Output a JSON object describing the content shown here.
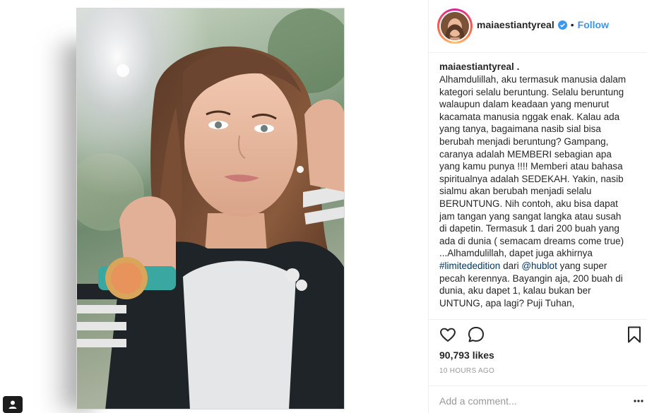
{
  "post": {
    "username": "maiaestiantyreal",
    "separator": "•",
    "follow_label": "Follow",
    "caption_user": "maiaestiantyreal",
    "caption_user_suffix": " .",
    "caption_lines": [
      "Alhamdulillah, aku termasuk manusia dalam",
      "kategori selalu beruntung. Selalu beruntung",
      "walaupun dalam keadaan yang menurut",
      "kacamata manusia nggak enak. Kalau ada",
      "yang tanya, bagaimana nasib sial bisa",
      "berubah menjadi beruntung? Gampang,",
      "caranya adalah MEMBERI sebagian apa",
      "yang kamu punya !!!! Memberi atau bahasa",
      "spiritualnya adalah SEDEKAH. Yakin, nasib",
      "sialmu akan berubah menjadi selalu",
      "BERUNTUNG. Nih contoh, aku bisa dapat",
      "jam tangan yang sangat langka atau susah",
      "di dapetin. Termasuk 1 dari 200 buah yang",
      "ada di dunia ( semacam dreams come true)",
      "...Alhamdulillah, dapet juga akhirnya"
    ],
    "hashtag": "#limitededition",
    "hashtag_mid": " dari ",
    "mention": "@hublot",
    "mention_after": " yang super",
    "caption_tail": [
      "pecah kerennya. Bayangin aja, 200 buah di",
      "dunia, aku dapet 1, kalau bukan ber",
      "UNTUNG, apa lagi? Puji Tuhan,"
    ],
    "likes": "90,793 likes",
    "time": "10 HOURS AGO",
    "comment_placeholder": "Add a comment..."
  },
  "icons": {
    "like": "heart-icon",
    "comment": "comment-bubble-icon",
    "save": "bookmark-icon",
    "verified": "verified-badge-icon",
    "more": "ellipsis-icon",
    "badge": "user-profile-icon"
  },
  "colors": {
    "link": "#3897f0",
    "hashtag": "#003569",
    "text": "#262626",
    "muted": "#999999"
  }
}
